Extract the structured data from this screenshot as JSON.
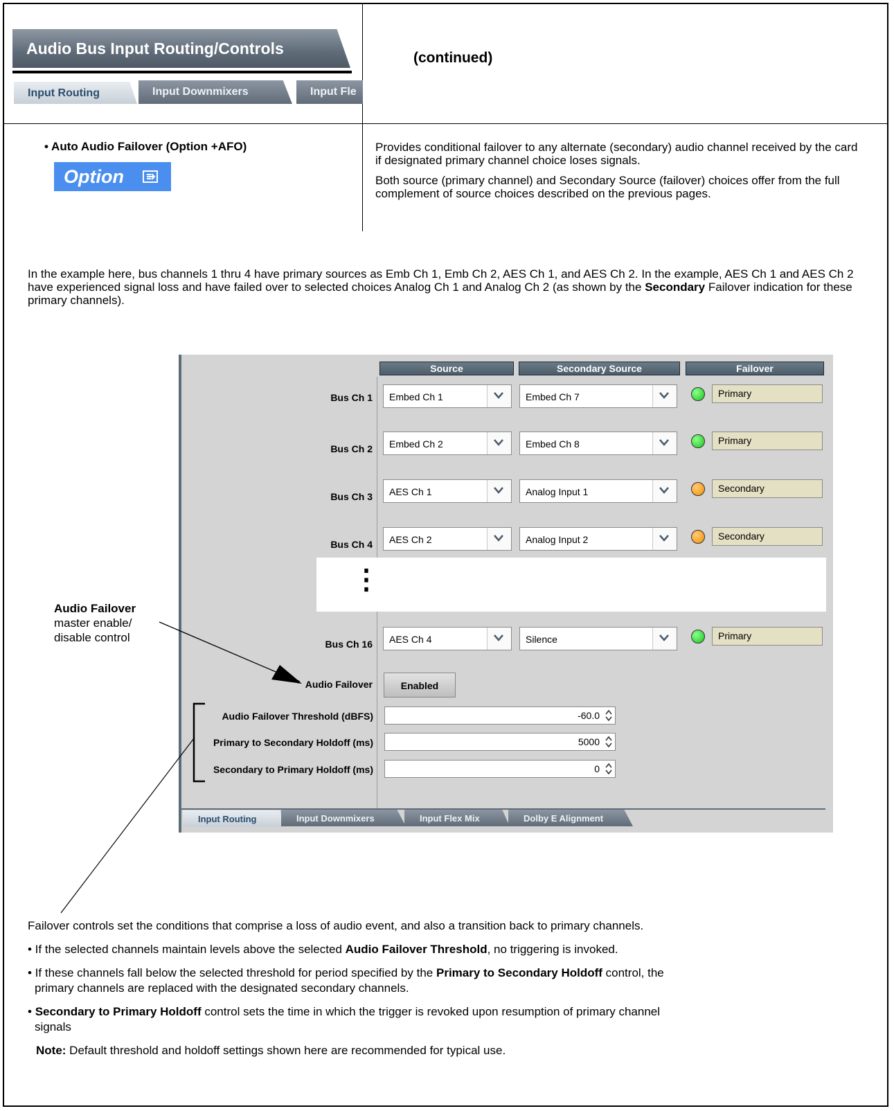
{
  "header": {
    "tab_banner_title": "Audio Bus Input Routing/Controls",
    "tabs": [
      "Input Routing",
      "Input Downmixers",
      "Input Fle"
    ],
    "continued": "(continued)"
  },
  "option_section": {
    "heading": "• Auto Audio Failover (Option +AFO)",
    "badge": "Option",
    "desc_1": "Provides conditional failover to any alternate (secondary) audio channel received by the card if designated primary channel choice loses signals.",
    "desc_2": "Both source (primary channel) and Secondary Source (failover) choices offer from the full complement of source choices described on the previous pages."
  },
  "intro": {
    "part1": "In the example here, bus channels 1 thru 4 have primary sources as Emb Ch 1, Emb Ch 2, AES Ch 1, and AES Ch 2. In the example, AES Ch 1 and AES Ch 2 have experienced signal loss and have failed over to selected choices Analog Ch 1 and Analog Ch 2 (as shown by the ",
    "bold": "Secondary",
    "part2": " Failover indication for these primary channels)."
  },
  "panel": {
    "col_headers": {
      "source": "Source",
      "secondary": "Secondary Source",
      "failover": "Failover"
    },
    "rows": [
      {
        "label": "Bus Ch 1",
        "source": "Embed Ch 1",
        "secondary": "Embed Ch 7",
        "status": "Primary",
        "led": "#18c418"
      },
      {
        "label": "Bus Ch 2",
        "source": "Embed Ch 2",
        "secondary": "Embed Ch 8",
        "status": "Primary",
        "led": "#18c418"
      },
      {
        "label": "Bus Ch 3",
        "source": "AES Ch 1",
        "secondary": "Analog Input 1",
        "status": "Secondary",
        "led": "#f29200"
      },
      {
        "label": "Bus Ch 4",
        "source": "AES Ch 2",
        "secondary": "Analog Input 2",
        "status": "Secondary",
        "led": "#f29200"
      },
      {
        "label": "Bus Ch 16",
        "source": "AES Ch 4",
        "secondary": "Silence",
        "status": "Primary",
        "led": "#18c418"
      }
    ],
    "ellipsis": "⋮",
    "audio_failover_label": "Audio Failover",
    "audio_failover_button": "Enabled",
    "threshold_label": "Audio Failover Threshold (dBFS)",
    "threshold_value": "-60.0",
    "p2s_label": "Primary to Secondary Holdoff (ms)",
    "p2s_value": "5000",
    "s2p_label": "Secondary to Primary Holdoff (ms)",
    "s2p_value": "0",
    "bottom_tabs": [
      "Input Routing",
      "Input Downmixers",
      "Input Flex Mix",
      "Dolby E Alignment"
    ]
  },
  "callout": {
    "bold": "Audio Failover",
    "line2": "master enable/",
    "line3": "disable control"
  },
  "footer": {
    "intro": "Failover controls set the conditions that comprise a loss of audio event, and also a transition back to primary channels.",
    "b1_pre": "• If the selected channels maintain levels above the selected ",
    "b1_bold": "Audio Failover Threshold",
    "b1_post": ", no triggering is invoked.",
    "b2_pre": "• If these channels fall below the selected threshold for period specified by the ",
    "b2_bold": "Primary to Secondary Holdoff",
    "b2_post": " control, the",
    "b2_line2": "primary channels are replaced with the designated secondary channels.",
    "b3_bullet": "• ",
    "b3_bold": "Secondary to Primary Holdoff",
    "b3_post": " control sets the time in which the trigger is revoked upon resumption of primary channel",
    "b3_line2": "signals",
    "note_bold": "Note:",
    "note_text": " Default threshold and holdoff settings shown here are recommended for typical use."
  }
}
